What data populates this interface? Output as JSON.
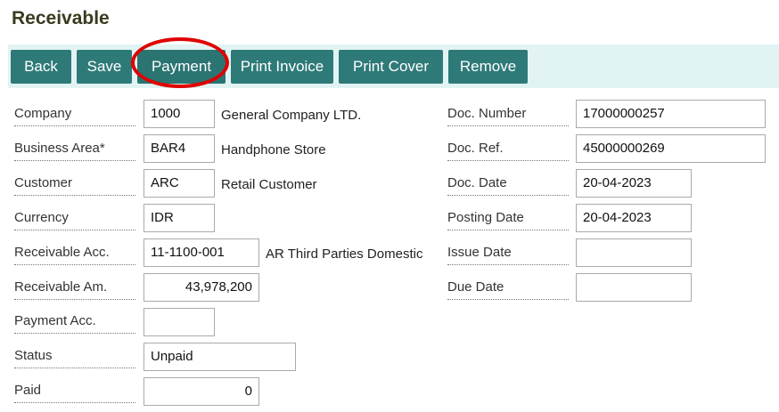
{
  "page": {
    "title": "Receivable"
  },
  "toolbar": {
    "back": "Back",
    "save": "Save",
    "payment": "Payment",
    "print_invoice": "Print Invoice",
    "print_cover": "Print Cover",
    "remove": "Remove"
  },
  "form": {
    "company": {
      "label": "Company",
      "value": "1000",
      "desc": "General Company LTD."
    },
    "business_area": {
      "label": "Business Area*",
      "value": "BAR4",
      "desc": "Handphone Store"
    },
    "customer": {
      "label": "Customer",
      "value": "ARC",
      "desc": "Retail Customer"
    },
    "currency": {
      "label": "Currency",
      "value": "IDR"
    },
    "receivable_acc": {
      "label": "Receivable Acc.",
      "value": "11-1100-001",
      "desc": "AR Third Parties Domestic"
    },
    "receivable_am": {
      "label": "Receivable Am.",
      "value": "43,978,200"
    },
    "payment_acc": {
      "label": "Payment Acc.",
      "value": ""
    },
    "status": {
      "label": "Status",
      "value": "Unpaid"
    },
    "paid": {
      "label": "Paid",
      "value": "0"
    },
    "doc_number": {
      "label": "Doc. Number",
      "value": "17000000257"
    },
    "doc_ref": {
      "label": "Doc. Ref.",
      "value": "45000000269"
    },
    "doc_date": {
      "label": "Doc. Date",
      "value": "20-04-2023"
    },
    "posting_date": {
      "label": "Posting Date",
      "value": "20-04-2023"
    },
    "issue_date": {
      "label": "Issue Date",
      "value": ""
    },
    "due_date": {
      "label": "Due Date",
      "value": ""
    }
  },
  "colors": {
    "button_bg": "#2e7a78",
    "toolbar_bg": "#e2f3f3",
    "highlight_circle": "#e00000"
  }
}
